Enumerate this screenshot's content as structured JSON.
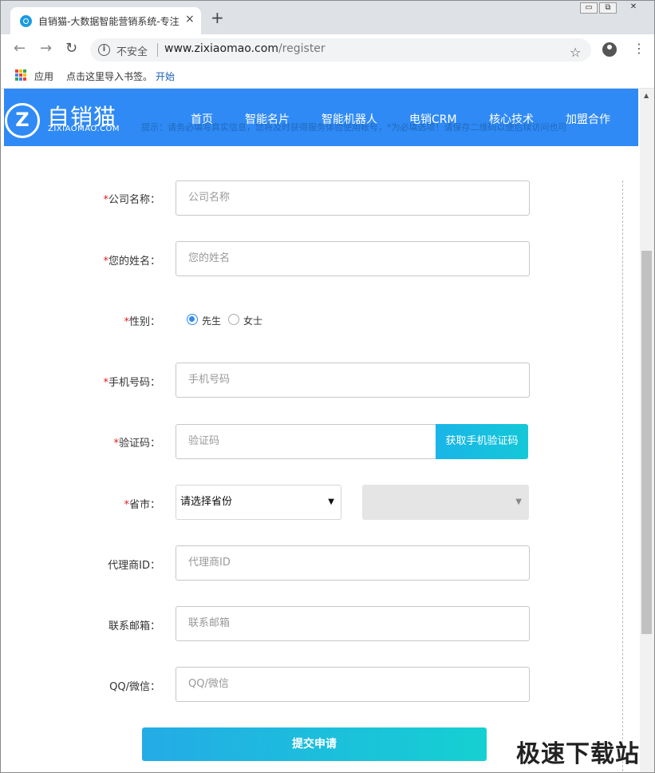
{
  "browser": {
    "tab_title": "自销猫-大数据智能营销系统-专注",
    "tab_close": "×",
    "new_tab": "+",
    "window_minimize": "▭",
    "window_maximize": "⧉",
    "window_close": "✕",
    "back": "←",
    "forward": "→",
    "reload": "↻",
    "info_icon": "i",
    "security_label": "不安全",
    "url_host": "www.zixiaomao.com",
    "url_path": "/register",
    "star": "☆",
    "menu": "⋮"
  },
  "bookmarks": {
    "apps": "应用",
    "hint": "点击这里导入书签。",
    "start": "开始",
    "apps_icon_colors": [
      "#ea4335",
      "#fbbc05",
      "#34a853",
      "#4285f4",
      "#ea4335",
      "#fbbc05",
      "#34a853",
      "#4285f4",
      "#ea4335"
    ]
  },
  "site": {
    "logo_mark": "Z",
    "logo_text": "自销猫",
    "logo_sub": "ZIXIAOMAO.COM",
    "nav": [
      "首页",
      "智能名片",
      "智能机器人",
      "电销CRM",
      "核心技术",
      "加盟合作"
    ],
    "notice": "提示：请务必填写真实信息，您将及时获得服务体验使用帐号，*为必填选项！请保存二维码以便后续访问也可"
  },
  "form": {
    "required_mark": "*",
    "company": {
      "label": "公司名称：",
      "placeholder": "公司名称"
    },
    "name": {
      "label": "您的姓名：",
      "placeholder": "您的姓名"
    },
    "gender": {
      "label": "性别：",
      "options": [
        "先生",
        "女士"
      ],
      "selected": "先生"
    },
    "phone": {
      "label": "手机号码：",
      "placeholder": "手机号码"
    },
    "code": {
      "label": "验证码：",
      "placeholder": "验证码",
      "button": "获取手机验证码"
    },
    "region": {
      "label": "省市：",
      "province_value": "请选择省份",
      "arrow": "▼",
      "city_arrow": "▼"
    },
    "agent": {
      "label": "代理商ID：",
      "placeholder": "代理商ID"
    },
    "email": {
      "label": "联系邮箱：",
      "placeholder": "联系邮箱"
    },
    "qq": {
      "label": "QQ/微信：",
      "placeholder": "QQ/微信"
    },
    "submit": "提交申请"
  },
  "scrollbar": {
    "up_arrow": "▲",
    "position_fraction": 0.45
  },
  "watermark": "极速下载站",
  "colors": {
    "header_blue": "#2f8af5",
    "accent_cyan": "#14c8d8",
    "required_red": "#e02020"
  }
}
